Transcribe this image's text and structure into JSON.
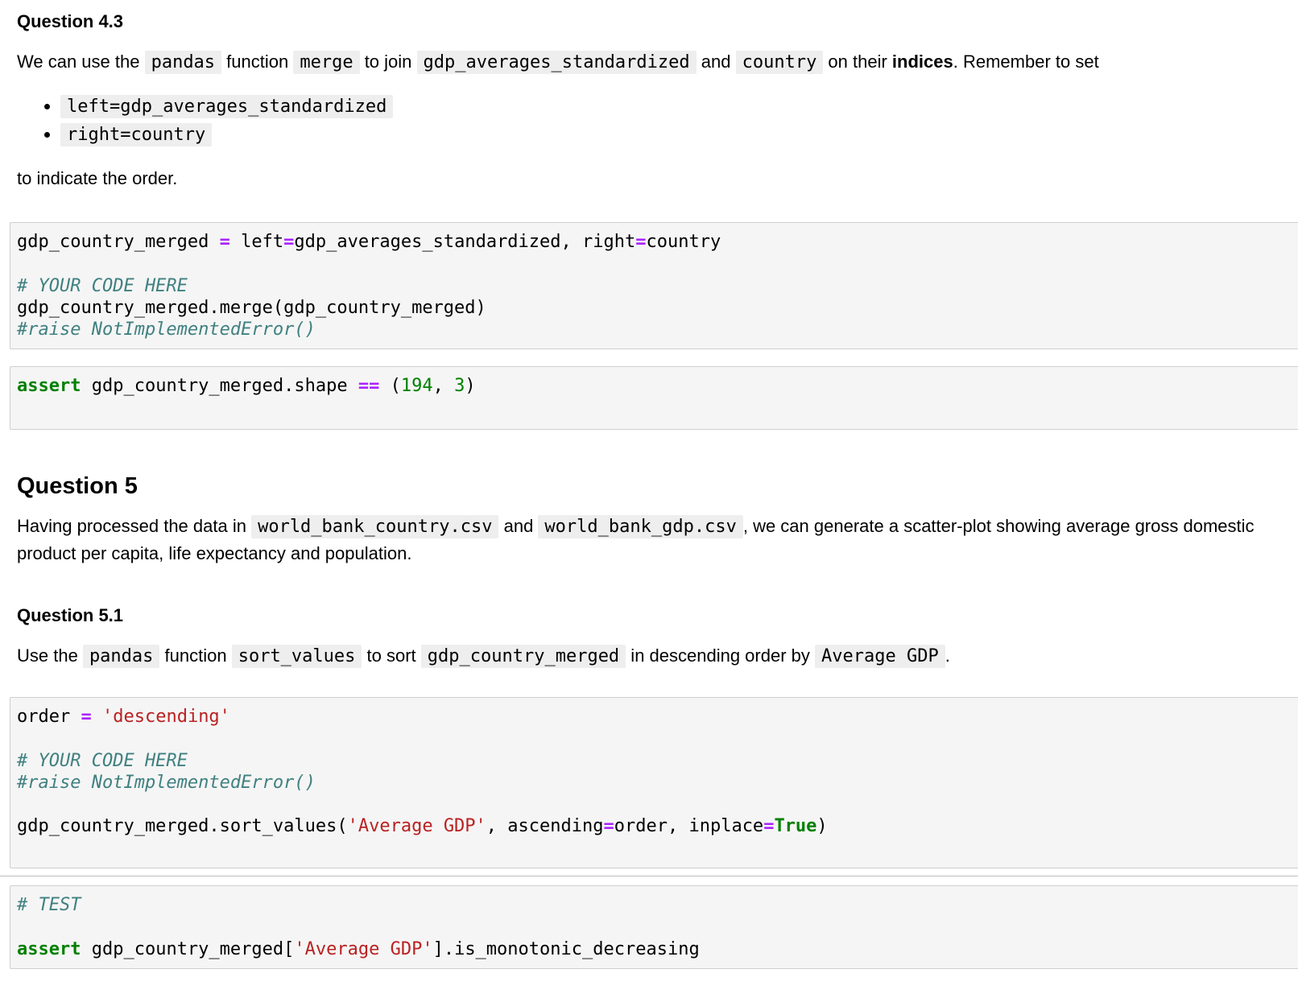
{
  "q43": {
    "title": "Question 4.3",
    "p1": {
      "t1": "We can use the ",
      "c1": "pandas",
      "t2": " function ",
      "c2": "merge",
      "t3": " to join ",
      "c3": "gdp_averages_standardized",
      "t4": " and ",
      "c4": "country",
      "t5": " on their ",
      "bold": "indices",
      "t6": ". Remember to set"
    },
    "bullets": [
      "left=gdp_averages_standardized",
      "right=country"
    ],
    "p2": "to indicate the order."
  },
  "cell1": {
    "l1": {
      "a": "gdp_country_merged ",
      "op": "=",
      "b": " left",
      "op2": "=",
      "c": "gdp_averages_standardized, right",
      "op3": "=",
      "d": "country"
    },
    "l3": "# YOUR CODE HERE",
    "l4": "gdp_country_merged.merge(gdp_country_merged)",
    "l5": "#raise NotImplementedError()"
  },
  "cell2": {
    "kw": "assert",
    "a": " gdp_country_merged.shape ",
    "op": "==",
    "b": " (",
    "n1": "194",
    "c": ", ",
    "n2": "3",
    "d": ")"
  },
  "q5": {
    "title": "Question 5",
    "p": {
      "t1": "Having processed the data in ",
      "c1": "world_bank_country.csv",
      "t2": " and ",
      "c2": "world_bank_gdp.csv",
      "t3": ", we can generate a scatter-plot showing average gross domestic product per capita, life expectancy and population."
    }
  },
  "q51": {
    "title": "Question 5.1",
    "p": {
      "t1": "Use the ",
      "c1": "pandas",
      "t2": " function ",
      "c2": "sort_values",
      "t3": " to sort ",
      "c3": "gdp_country_merged",
      "t4": " in descending order by ",
      "c4": "Average GDP",
      "t5": "."
    }
  },
  "cell3": {
    "l1a": "order ",
    "l1op": "=",
    "l1b": " ",
    "l1s": "'descending'",
    "l3": "# YOUR CODE HERE",
    "l4": "#raise NotImplementedError()",
    "l6a": "gdp_country_merged.sort_values(",
    "l6s": "'Average GDP'",
    "l6b": ", ascending",
    "l6op": "=",
    "l6c": "order, inplace",
    "l6op2": "=",
    "l6kw": "True",
    "l6d": ")"
  },
  "cell4": {
    "l1": "# TEST",
    "kw": "assert",
    "a": " gdp_country_merged[",
    "s": "'Average GDP'",
    "b": "].is_monotonic_decreasing"
  }
}
